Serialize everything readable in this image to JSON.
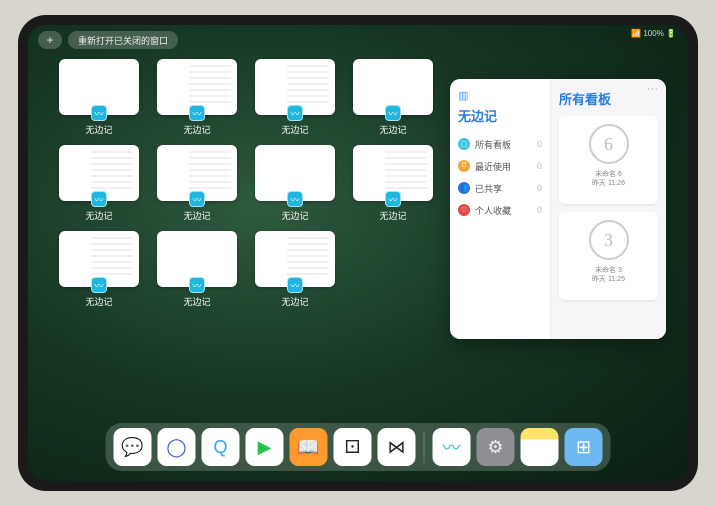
{
  "topbar": {
    "plus": "+",
    "reopen_label": "重新打开已关闭的窗口"
  },
  "status_text": "📶 100% 🔋",
  "app_label": "无边记",
  "window_count": 11,
  "window_variants": [
    "blank",
    "detail",
    "detail",
    "blank",
    "detail",
    "detail",
    "blank",
    "detail",
    "detail",
    "blank",
    "detail"
  ],
  "popover": {
    "more": "···",
    "left_title": "无边记",
    "items": [
      {
        "icon_bg": "#3fc4e4",
        "glyph": "▢",
        "label": "所有看板",
        "count": 0
      },
      {
        "icon_bg": "#f2a63b",
        "glyph": "⏱",
        "label": "最近使用",
        "count": 0
      },
      {
        "icon_bg": "#2f6fe0",
        "glyph": "👥",
        "label": "已共享",
        "count": 0
      },
      {
        "icon_bg": "#e24a4a",
        "glyph": "♡",
        "label": "个人收藏",
        "count": 0
      }
    ],
    "right_title": "所有看板",
    "boards": [
      {
        "sketch": "6",
        "name": "未命名 6",
        "time": "昨天 11:26"
      },
      {
        "sketch": "3",
        "name": "未命名 3",
        "time": "昨天 11:25"
      }
    ]
  },
  "dock": {
    "left": [
      {
        "name": "wechat-icon",
        "bg": "#ffffff",
        "glyph": "💬",
        "color": "#09bb07"
      },
      {
        "name": "browser1-icon",
        "bg": "#ffffff",
        "glyph": "◯",
        "color": "#2d5be3"
      },
      {
        "name": "quark-icon",
        "bg": "#ffffff",
        "glyph": "Q",
        "color": "#2aa8ff"
      },
      {
        "name": "play-icon",
        "bg": "#ffffff",
        "glyph": "▶",
        "color": "#2bbf4a"
      },
      {
        "name": "books-icon",
        "bg": "#ff9a2e",
        "glyph": "📖",
        "color": "#fff"
      },
      {
        "name": "dice-icon",
        "bg": "#ffffff",
        "glyph": "⚀",
        "color": "#222"
      },
      {
        "name": "connect-icon",
        "bg": "#ffffff",
        "glyph": "⋈",
        "color": "#222"
      }
    ],
    "right": [
      {
        "name": "freeform-icon",
        "bg": "#ffffff",
        "glyph": "〰",
        "color": "#1fb6e0"
      },
      {
        "name": "settings-icon",
        "bg": "#8e8e93",
        "glyph": "⚙",
        "color": "#eee"
      },
      {
        "name": "notes-icon",
        "bg": "linear-gradient(#ffe46b 30%,#fff 30%)",
        "glyph": "",
        "color": "#000"
      },
      {
        "name": "apps-icon",
        "bg": "#6fb9f2",
        "glyph": "⊞",
        "color": "#fff"
      }
    ]
  }
}
